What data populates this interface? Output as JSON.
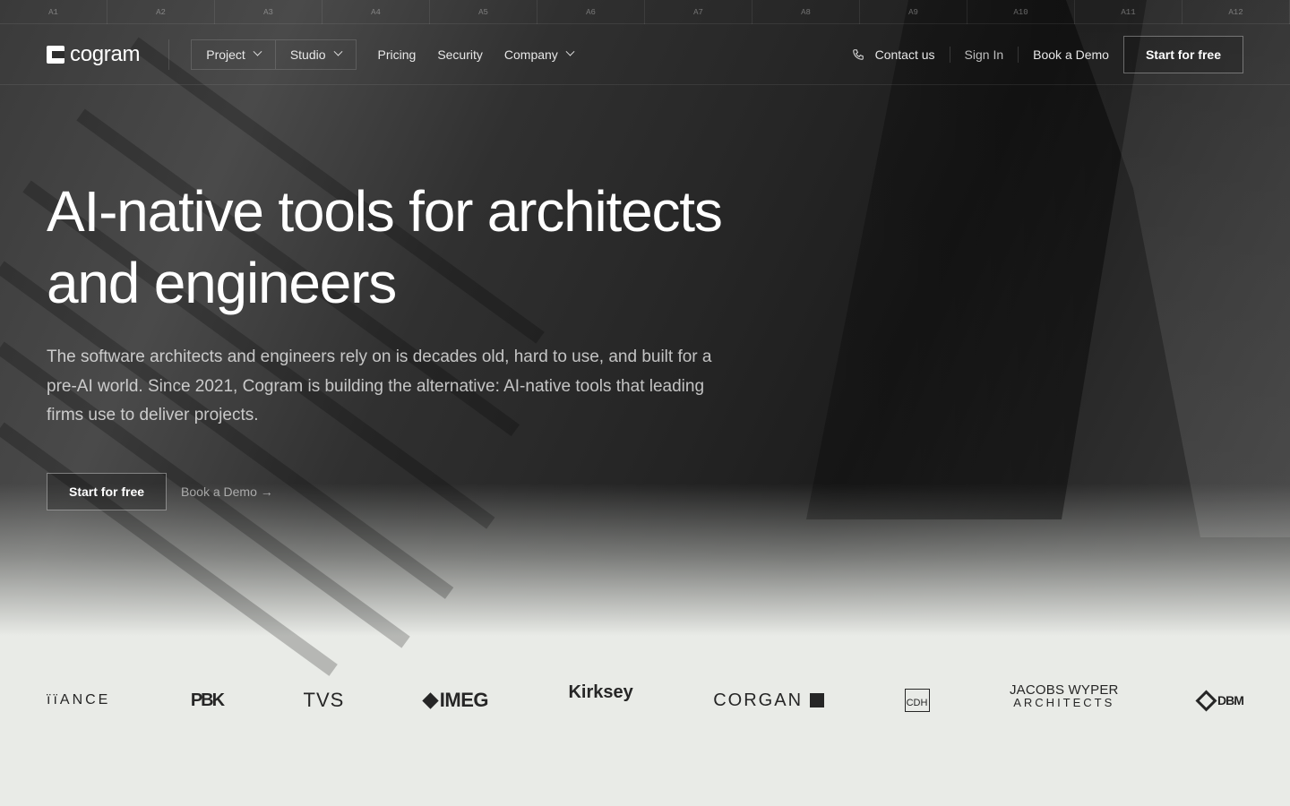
{
  "grid_labels": [
    "A1",
    "A2",
    "A3",
    "A4",
    "A5",
    "A6",
    "A7",
    "A8",
    "A9",
    "A10",
    "A11",
    "A12"
  ],
  "nav": {
    "logo_text": "cogram",
    "project_label": "Project",
    "studio_label": "Studio",
    "pricing_label": "Pricing",
    "security_label": "Security",
    "company_label": "Company",
    "contact_label": "Contact us",
    "signin_label": "Sign In",
    "demo_label": "Book a Demo",
    "start_label": "Start for free"
  },
  "hero": {
    "headline_line1": "AI-native tools for architects",
    "headline_line2": "and engineers",
    "lead": "The software architects and engineers rely on is decades old, hard to use, and built for a pre-AI world. Since 2021, Cogram is building the alternative: AI-native tools that leading firms use to deliver projects.",
    "cta_primary": "Start for free",
    "cta_secondary": "Book a Demo →"
  },
  "logos": {
    "aance": "ïïANCE",
    "pbk": "PBK",
    "tvs": "TVS",
    "imeg": "IMEG",
    "kirksey": "Kirksey",
    "corgan": "CORGAN",
    "cdh": "CDH",
    "jw_line1": "JACOBS WYPER",
    "jw_line2": "ARCHITECTS",
    "dbm": "DBM"
  }
}
